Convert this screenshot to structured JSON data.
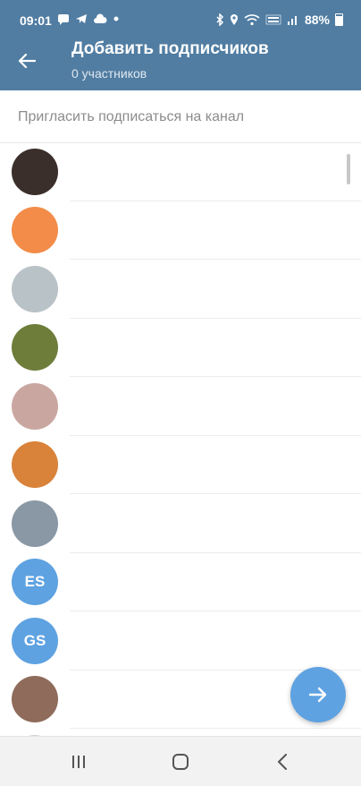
{
  "status_bar": {
    "time": "09:01",
    "battery": "88%"
  },
  "header": {
    "title": "Добавить подписчиков",
    "subtitle": "0 участников"
  },
  "search": {
    "placeholder": "Пригласить подписаться на канал",
    "value": ""
  },
  "contacts": [
    {
      "initials": "",
      "avatar_color": "#3a2f2a"
    },
    {
      "initials": "",
      "avatar_color": "#f28c48"
    },
    {
      "initials": "",
      "avatar_color": "#b9c2c7"
    },
    {
      "initials": "",
      "avatar_color": "#6e7d3a"
    },
    {
      "initials": "",
      "avatar_color": "#c9a7a0"
    },
    {
      "initials": "",
      "avatar_color": "#d9823a"
    },
    {
      "initials": "",
      "avatar_color": "#8a98a5"
    },
    {
      "initials": "ES",
      "avatar_color": "#5ea2e1"
    },
    {
      "initials": "GS",
      "avatar_color": "#5ea2e1"
    },
    {
      "initials": "",
      "avatar_color": "#8e6b5a"
    },
    {
      "initials": "",
      "avatar_color": "#cfcfcf"
    }
  ],
  "colors": {
    "header": "#517da2",
    "fab": "#5ea2e1",
    "avatar_blue": "#5ea2e1"
  },
  "icons": {
    "back": "arrow-left-icon",
    "fab": "arrow-right-icon",
    "nav_recents": "recents-icon",
    "nav_home": "home-icon",
    "nav_back": "back-chevron-icon"
  }
}
